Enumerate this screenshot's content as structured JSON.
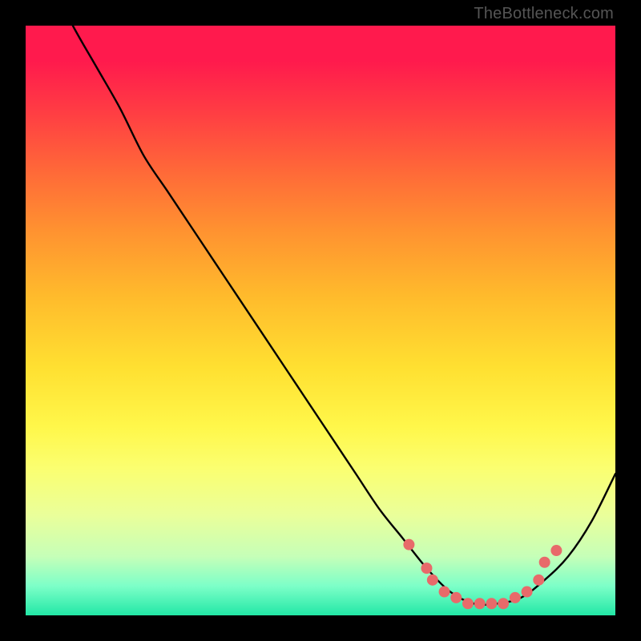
{
  "watermark": "TheBottleneck.com",
  "colors": {
    "background": "#000000",
    "curve_stroke": "#000000",
    "marker_fill": "#e86a6a",
    "marker_stroke": "#d85a5a"
  },
  "chart_data": {
    "type": "line",
    "title": "",
    "xlabel": "",
    "ylabel": "",
    "xlim": [
      0,
      100
    ],
    "ylim": [
      0,
      100
    ],
    "series": [
      {
        "name": "bottleneck-curve",
        "x": [
          0,
          4,
          8,
          12,
          16,
          20,
          24,
          28,
          32,
          36,
          40,
          44,
          48,
          52,
          56,
          60,
          64,
          68,
          72,
          76,
          80,
          84,
          88,
          92,
          96,
          100
        ],
        "y": [
          115,
          108,
          100,
          93,
          86,
          78,
          72,
          66,
          60,
          54,
          48,
          42,
          36,
          30,
          24,
          18,
          13,
          8,
          4,
          2,
          2,
          3,
          6,
          10,
          16,
          24
        ]
      }
    ],
    "markers": {
      "name": "highlighted-points",
      "x": [
        65,
        68,
        69,
        71,
        73,
        75,
        77,
        79,
        81,
        83,
        85,
        87,
        88,
        90
      ],
      "y": [
        12,
        8,
        6,
        4,
        3,
        2,
        2,
        2,
        2,
        3,
        4,
        6,
        9,
        11
      ]
    },
    "gradient_stops": [
      {
        "pos": 0.0,
        "color": "#ff1a4d"
      },
      {
        "pos": 0.06,
        "color": "#ff1a4d"
      },
      {
        "pos": 0.14,
        "color": "#ff3a44"
      },
      {
        "pos": 0.25,
        "color": "#ff6a38"
      },
      {
        "pos": 0.35,
        "color": "#ff9330"
      },
      {
        "pos": 0.46,
        "color": "#ffbb2c"
      },
      {
        "pos": 0.58,
        "color": "#ffe031"
      },
      {
        "pos": 0.68,
        "color": "#fff74a"
      },
      {
        "pos": 0.75,
        "color": "#fbff70"
      },
      {
        "pos": 0.83,
        "color": "#eaff9a"
      },
      {
        "pos": 0.9,
        "color": "#c6ffb8"
      },
      {
        "pos": 0.95,
        "color": "#7dffc8"
      },
      {
        "pos": 1.0,
        "color": "#22e7a6"
      }
    ]
  }
}
